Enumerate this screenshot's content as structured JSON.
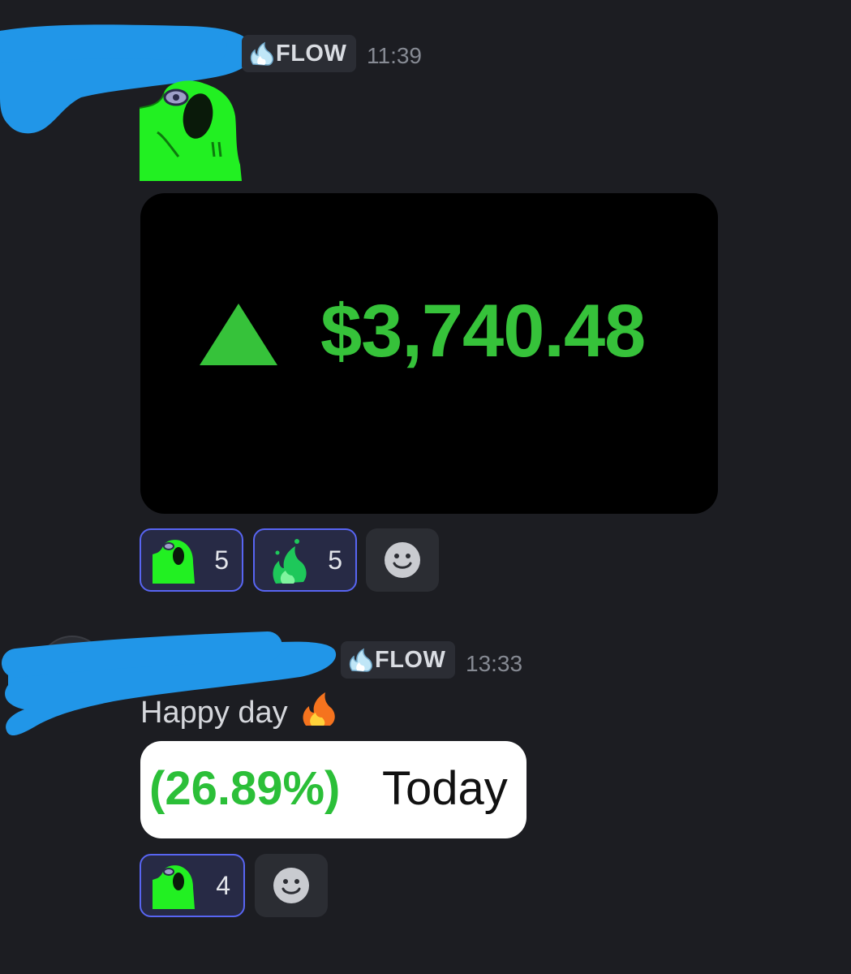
{
  "messages": [
    {
      "role_tag": "FLOW",
      "time": "11:39",
      "image_text": {
        "value": "$3,740.48"
      },
      "reactions": [
        {
          "emoji": "frog-emoji",
          "count": "5"
        },
        {
          "emoji": "green-fire-emoji",
          "count": "5"
        }
      ]
    },
    {
      "role_tag": "FLOW",
      "time": "13:33",
      "text": "Happy day",
      "image_text": {
        "percent": "(26.89%)",
        "label": "Today"
      },
      "reactions": [
        {
          "emoji": "frog-emoji",
          "count": "4"
        }
      ]
    }
  ],
  "colors": {
    "background": "#1c1d22",
    "accent_green": "#36c23a",
    "reaction_border": "#5865f2",
    "timestamp": "#868a93"
  }
}
